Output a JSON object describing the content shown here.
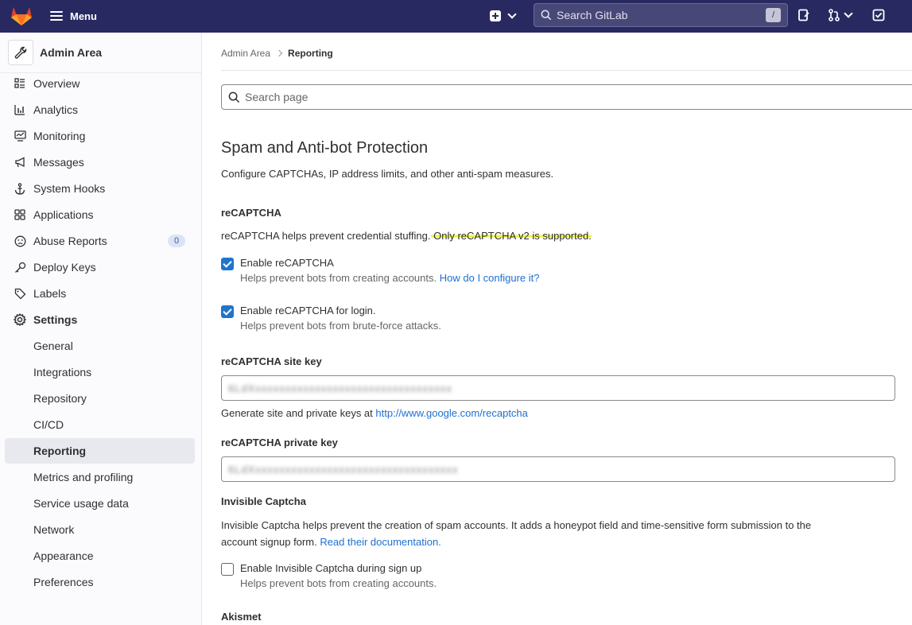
{
  "topbar": {
    "menu_label": "Menu",
    "search_placeholder": "Search GitLab",
    "search_shortcut": "/"
  },
  "sidebar": {
    "title": "Admin Area",
    "items": [
      {
        "label": "Overview",
        "icon": "overview-icon"
      },
      {
        "label": "Analytics",
        "icon": "analytics-icon"
      },
      {
        "label": "Monitoring",
        "icon": "monitor-icon"
      },
      {
        "label": "Messages",
        "icon": "megaphone-icon"
      },
      {
        "label": "System Hooks",
        "icon": "anchor-icon"
      },
      {
        "label": "Applications",
        "icon": "applications-icon"
      },
      {
        "label": "Abuse Reports",
        "icon": "abuse-icon",
        "badge": "0"
      },
      {
        "label": "Deploy Keys",
        "icon": "key-icon"
      },
      {
        "label": "Labels",
        "icon": "label-icon"
      },
      {
        "label": "Settings",
        "icon": "settings-icon"
      }
    ],
    "settings_subitems": [
      {
        "label": "General"
      },
      {
        "label": "Integrations"
      },
      {
        "label": "Repository"
      },
      {
        "label": "CI/CD"
      },
      {
        "label": "Reporting",
        "active": true
      },
      {
        "label": "Metrics and profiling"
      },
      {
        "label": "Service usage data"
      },
      {
        "label": "Network"
      },
      {
        "label": "Appearance"
      },
      {
        "label": "Preferences"
      }
    ]
  },
  "breadcrumb": {
    "parent": "Admin Area",
    "current": "Reporting"
  },
  "page_search": {
    "placeholder": "Search page"
  },
  "main": {
    "title": "Spam and Anti-bot Protection",
    "description": "Configure CAPTCHAs, IP address limits, and other anti-spam measures.",
    "recaptcha": {
      "heading": "reCAPTCHA",
      "intro": "reCAPTCHA helps prevent credential stuffing.",
      "intro_highlight": " Only reCAPTCHA v2 is supported.",
      "enable_label": "Enable reCAPTCHA",
      "enable_checked": true,
      "enable_help": "Helps prevent bots from creating accounts.",
      "enable_help_link": "How do I configure it?",
      "login_label": "Enable reCAPTCHA for login.",
      "login_checked": true,
      "login_help": "Helps prevent bots from brute-force attacks.",
      "site_key_label": "reCAPTCHA site key",
      "site_key_value": "6LdXxxxxxxxxxxxxxxxxxxxxxxxxxxxxxxxxx",
      "keys_hint": "Generate site and private keys at",
      "keys_link": "http://www.google.com/recaptcha",
      "private_key_label": "reCAPTCHA private key",
      "private_key_value": "6LdXxxxxxxxxxxxxxxxxxxxxxxxxxxxxxxxxxx"
    },
    "invisible": {
      "heading": "Invisible Captcha",
      "intro_line1": "Invisible Captcha helps prevent the creation of spam accounts. It adds a honeypot field and time-sensitive form submission to the",
      "intro_line2": "account signup form.",
      "intro_link": "Read their documentation.",
      "enable_label": "Enable Invisible Captcha during sign up",
      "enable_checked": false,
      "enable_help": "Helps prevent bots from creating accounts."
    },
    "akismet_heading": "Akismet"
  }
}
